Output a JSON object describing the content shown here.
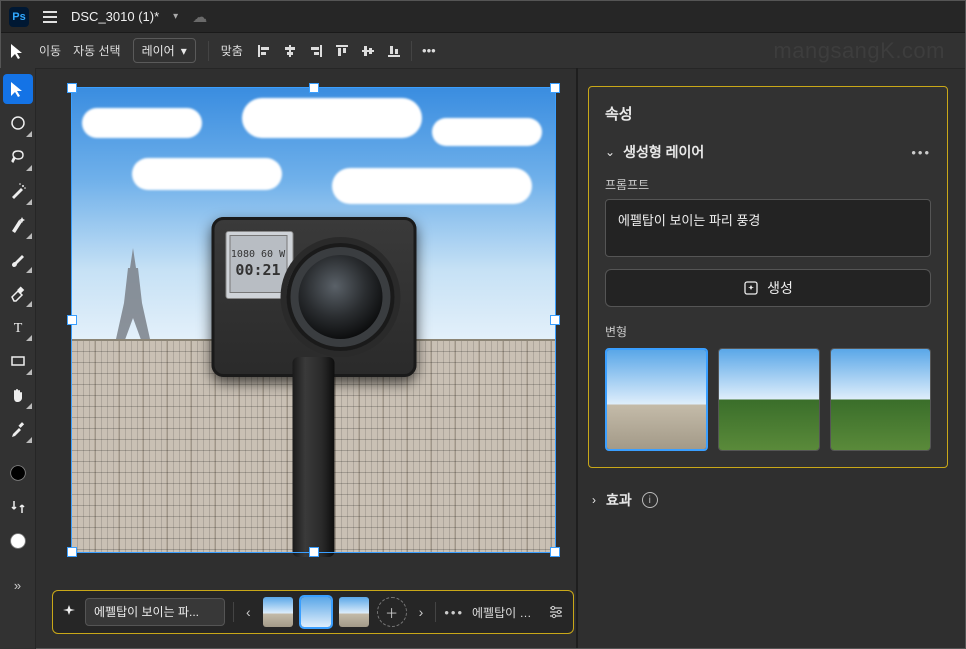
{
  "titlebar": {
    "doc_name": "DSC_3010 (1)*"
  },
  "watermark": "mangsangK.com",
  "options": {
    "move_label": "이동",
    "auto_select_label": "자동 선택",
    "layer_select": "레이어",
    "align_label": "맞춤"
  },
  "camera_lcd": {
    "line1": "1080 60 W",
    "line2": "00:21"
  },
  "context_bar": {
    "prompt_short": "에펠탑이 보이는 파...",
    "result_short": "에펠탑이 보이..."
  },
  "panel": {
    "title": "속성",
    "section": "생성형 레이어",
    "prompt_label": "프롬프트",
    "prompt_value": "에펠탑이 보이는 파리 풍경",
    "generate_label": "생성",
    "variations_label": "변형",
    "effects_label": "효과"
  }
}
